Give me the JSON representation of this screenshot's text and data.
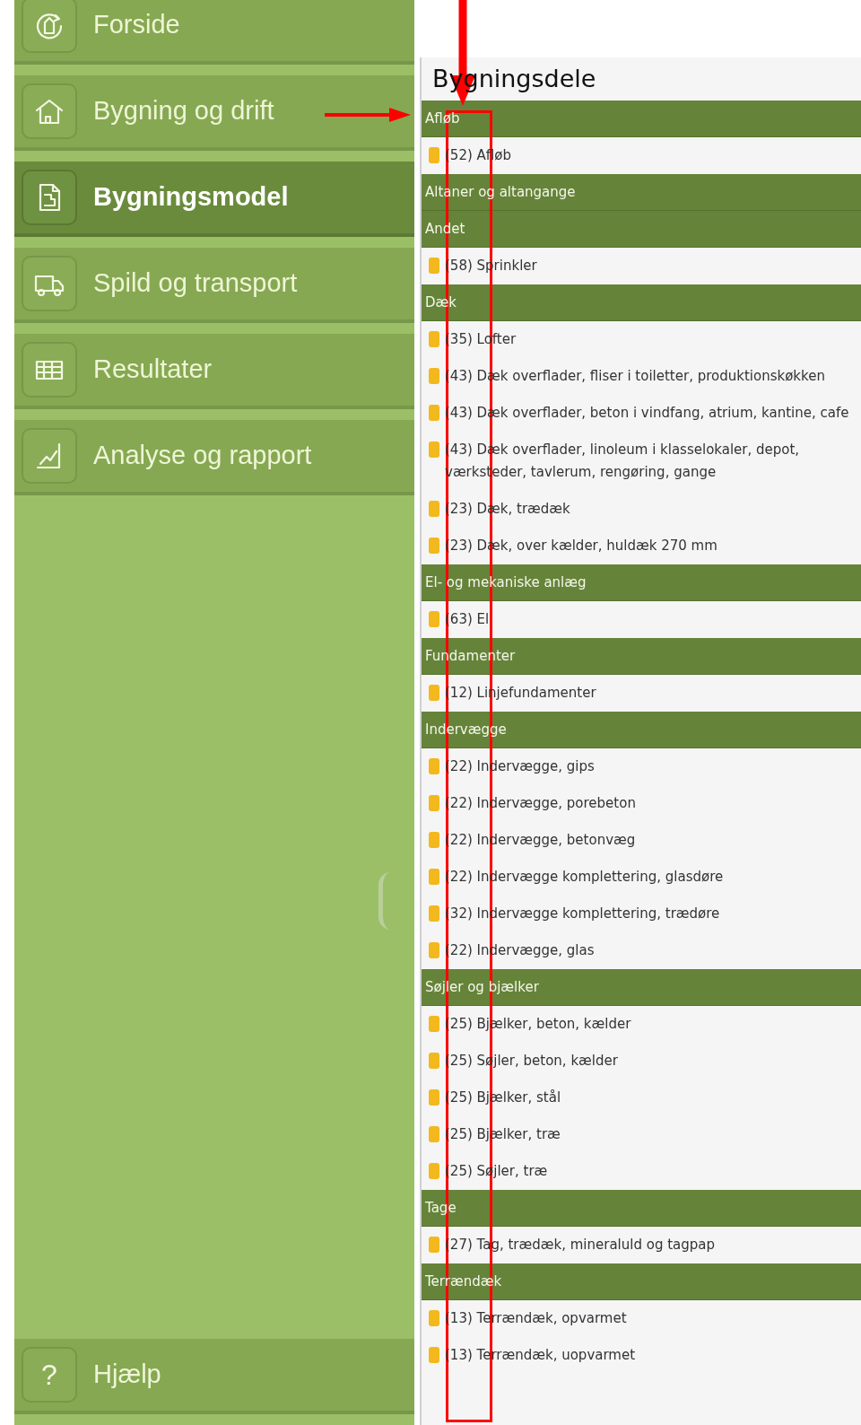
{
  "sidebar": {
    "items": [
      {
        "label": "Forside",
        "selected": false
      },
      {
        "label": "Bygning og drift",
        "selected": false
      },
      {
        "label": "Bygningsmodel",
        "selected": true
      },
      {
        "label": "Spild og transport",
        "selected": false
      },
      {
        "label": "Resultater",
        "selected": false
      },
      {
        "label": "Analyse og rapport",
        "selected": false
      }
    ],
    "help": {
      "icon_text": "?",
      "label": "Hjælp"
    }
  },
  "panel": {
    "title": "Bygningsdele",
    "groups": [
      {
        "name": "Afløb",
        "items": [
          "(52) Afløb"
        ]
      },
      {
        "name": "Altaner og altangange"
      },
      {
        "name": "Andet",
        "items": [
          "(58) Sprinkler"
        ]
      },
      {
        "name": "Dæk",
        "items": [
          "(35) Lofter",
          "(43) Dæk overflader, fliser i toiletter, produktionskøkken",
          "(43) Dæk overflader, beton i vindfang, atrium, kantine, cafe",
          "(43) Dæk overflader, linoleum i klasselokaler, depot, værksteder, tavlerum, rengøring, gange",
          "(23) Dæk, trædæk",
          "(23) Dæk, over kælder, huldæk 270 mm"
        ]
      },
      {
        "name": "El- og mekaniske anlæg",
        "items": [
          "(63) El"
        ]
      },
      {
        "name": "Fundamenter",
        "items": [
          "(12) Linjefundamenter"
        ]
      },
      {
        "name": "Indervægge",
        "items": [
          "(22) Indervægge, gips",
          "(22) Indervægge, porebeton",
          "(22) Indervægge, betonvæg",
          "(22) Indervægge komplettering, glasdøre",
          "(32) Indervægge komplettering, trædøre",
          "(22) Indervægge, glas"
        ]
      },
      {
        "name": "Søjler og bjælker",
        "items": [
          "(25) Bjælker, beton, kælder",
          "(25) Søjler, beton, kælder",
          "(25) Bjælker, stål",
          "(25) Bjælker, træ",
          "(25) Søjler, træ"
        ]
      },
      {
        "name": "Tage",
        "items": [
          "(27) Tag, trædæk, mineraluld og tagpap"
        ]
      },
      {
        "name": "Terrændæk",
        "items": [
          "(13) Terrændæk, opvarmet",
          "(13) Terrændæk, uopvarmet"
        ]
      }
    ]
  }
}
